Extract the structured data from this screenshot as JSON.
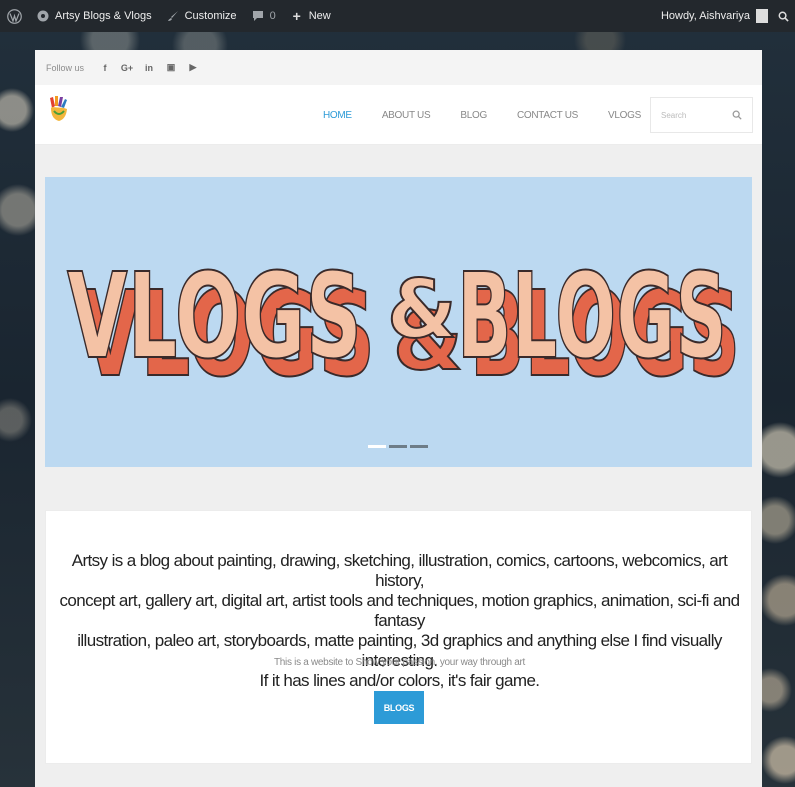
{
  "admin_bar": {
    "site_name": "Artsy Blogs & Vlogs",
    "customize": "Customize",
    "comments_count": "0",
    "new": "New",
    "howdy": "Howdy, Aishvariya"
  },
  "topbar": {
    "follow_text": "Follow us",
    "social": [
      "f",
      "G+",
      "in",
      "▣",
      "▶"
    ]
  },
  "nav": {
    "items": [
      "HOME",
      "ABOUT US",
      "BLOG",
      "CONTACT US",
      "VLOGS"
    ],
    "search_placeholder": "Search"
  },
  "banner": {
    "word1": "VLOGS",
    "amp": "&",
    "word2": "BLOGS"
  },
  "content": {
    "lead_lines": [
      "Artsy is a blog about painting, drawing, sketching, illustration, comics, cartoons, webcomics, art history,",
      "concept art, gallery art, digital art, artist tools and techniques, motion graphics, animation, sci-fi and fantasy",
      "illustration, paleo art, storyboards, matte painting, 3d graphics and anything else I find visually interesting.",
      "If it has lines and/or colors, it's fair game."
    ],
    "subtitle": "This is a website to Show your passion, your way through art",
    "button": "BLOGS"
  },
  "colors": {
    "accent": "#2d9bd7",
    "banner_bg": "#bcd9f1",
    "letter_fill": "#f4c2a5",
    "letter_shadow": "#e3664a"
  }
}
